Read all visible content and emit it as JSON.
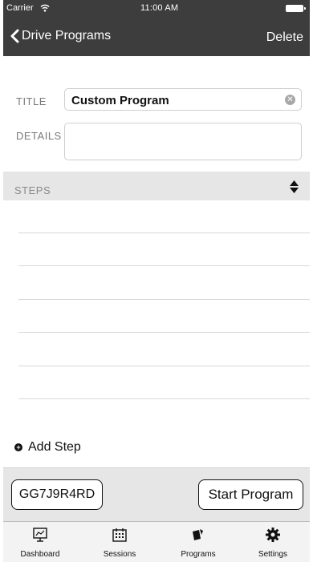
{
  "status": {
    "carrier": "Carrier",
    "time": "11:00 AM"
  },
  "nav": {
    "back_label": "Drive Programs",
    "delete_label": "Delete"
  },
  "form": {
    "title_label": "TITLE",
    "title_value": "Custom Program",
    "details_label": "DETAILS",
    "details_value": ""
  },
  "steps": {
    "header_label": "STEPS",
    "rows": [
      "",
      "",
      "",
      "",
      "",
      ""
    ]
  },
  "add_step_label": "Add Step",
  "actions": {
    "code_label": "GG7J9R4RD",
    "start_label": "Start Program"
  },
  "tabs": [
    {
      "label": "Dashboard",
      "icon": "dashboard-icon"
    },
    {
      "label": "Sessions",
      "icon": "calendar-icon"
    },
    {
      "label": "Programs",
      "icon": "programs-icon"
    },
    {
      "label": "Settings",
      "icon": "gear-icon"
    }
  ],
  "colors": {
    "nav_background": "#3d3d3d",
    "section_background": "#e6e6e6",
    "tabbar_background": "#f3f3f3"
  }
}
